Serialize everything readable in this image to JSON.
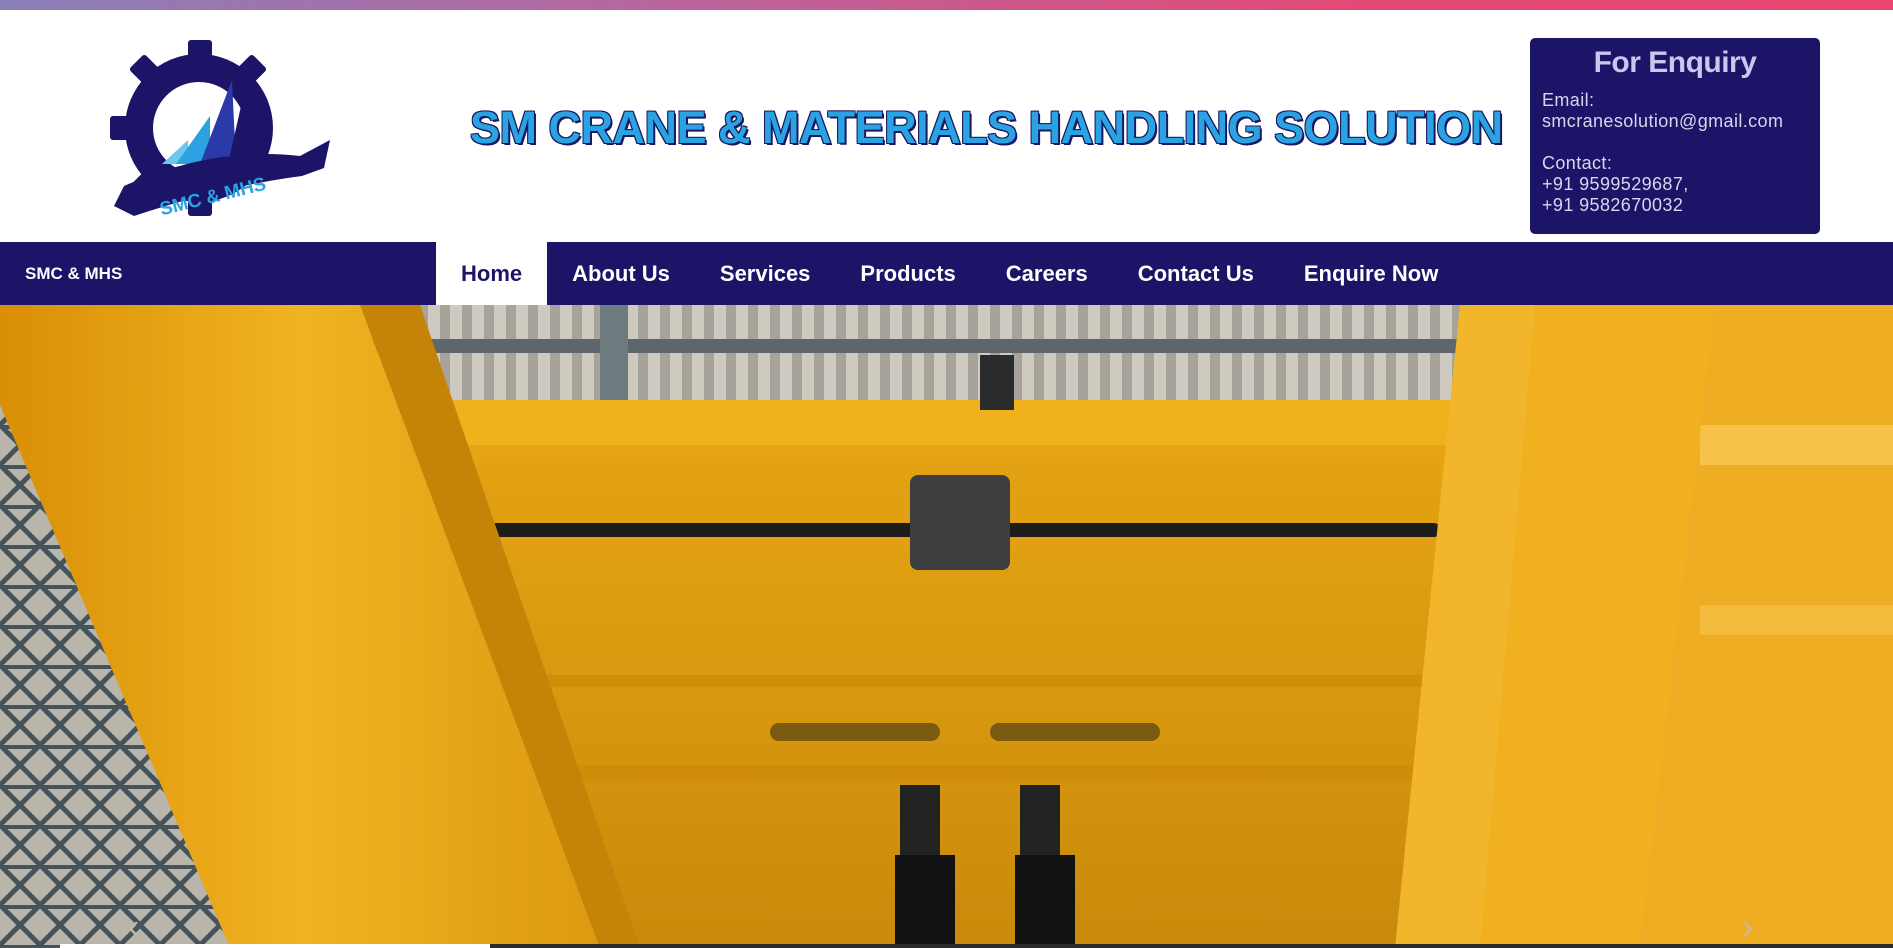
{
  "header": {
    "logo_text": "SMC & MHS",
    "site_title": "SM CRANE & MATERIALS HANDLING SOLUTION"
  },
  "enquiry": {
    "title": "For Enquiry",
    "email_label": "Email:",
    "email": "smcranesolution@gmail.com",
    "contact_label": "Contact:",
    "phone_1": "+91 9599529687,",
    "phone_2": "+91 9582670032"
  },
  "navbar": {
    "brand": "SMC & MHS",
    "items": [
      {
        "label": "Home",
        "active": true
      },
      {
        "label": "About Us"
      },
      {
        "label": "Services"
      },
      {
        "label": "Products"
      },
      {
        "label": "Careers"
      },
      {
        "label": "Contact Us"
      },
      {
        "label": "Enquire Now"
      }
    ]
  },
  "carousel": {
    "image": "crane-photo",
    "prev_icon": "chevron-left-icon",
    "next_icon": "chevron-right-icon"
  },
  "colors": {
    "navy": "#1b1467",
    "title_blue": "#2ba3e3",
    "crane_yellow": "#e8a214"
  }
}
